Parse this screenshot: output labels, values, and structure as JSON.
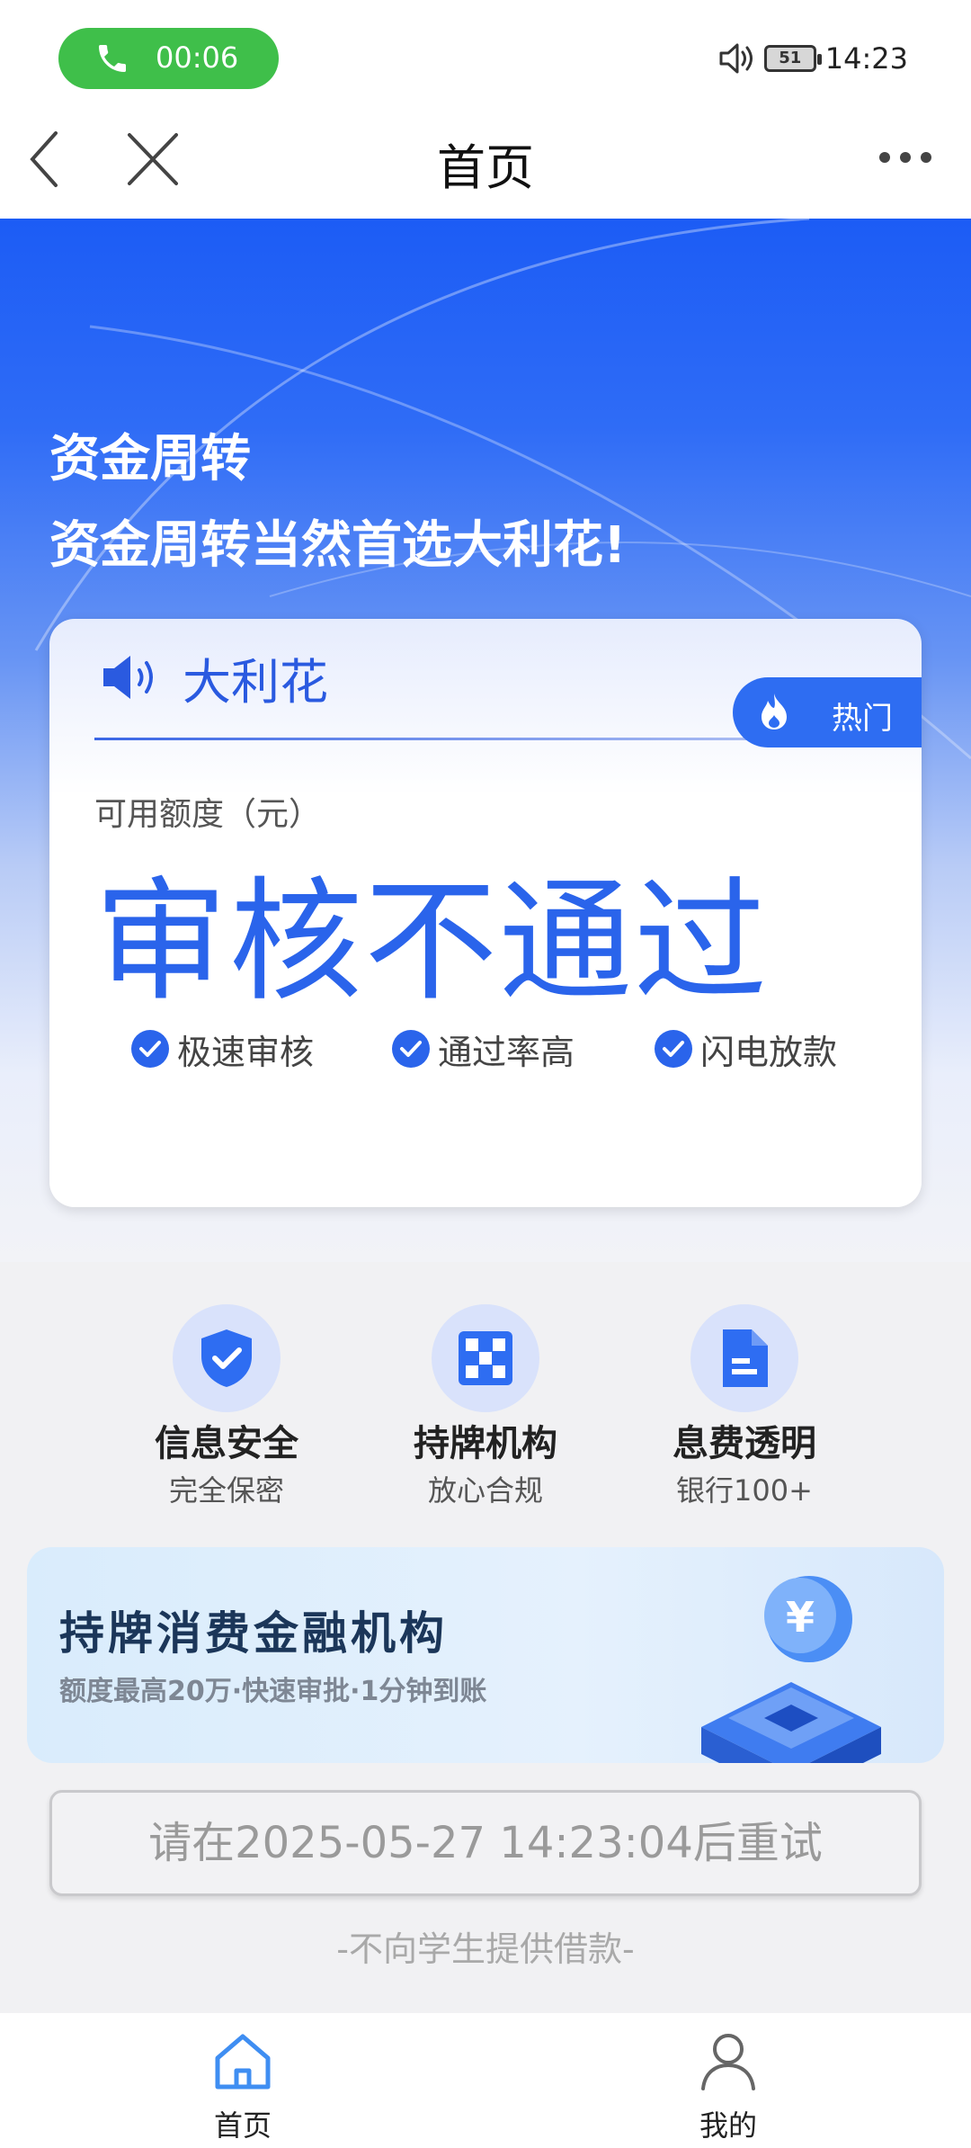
{
  "status_bar": {
    "call_timer": "00:06",
    "battery": "51",
    "clock": "14:23"
  },
  "nav": {
    "title": "首页"
  },
  "hero": {
    "headline1": "资金周转",
    "headline2": "资金周转当然首选大利花!"
  },
  "card": {
    "brand": "大利花",
    "hot_badge": "热门",
    "available_label": "可用额度（元）",
    "status_value": "审核不通过",
    "features": [
      "极速审核",
      "通过率高",
      "闪电放款"
    ]
  },
  "info": [
    {
      "title": "信息安全",
      "sub": "完全保密",
      "icon": "shield-check-icon"
    },
    {
      "title": "持牌机构",
      "sub": "放心合规",
      "icon": "checker-grid-icon"
    },
    {
      "title": "息费透明",
      "sub": "银行100+",
      "icon": "document-icon"
    }
  ],
  "banner": {
    "title": "持牌消费金融机构",
    "subtitle": "额度最高20万·快速审批·1分钟到账"
  },
  "retry_button": "请在2025-05-27 14:23:04后重试",
  "notice": "-不向学生提供借款-",
  "tabs": [
    {
      "label": "首页",
      "icon": "home-icon",
      "active": true
    },
    {
      "label": "我的",
      "icon": "user-icon",
      "active": false
    }
  ],
  "colors": {
    "accent": "#2a64eb",
    "call_green": "#3fbf4a",
    "hero_top": "#1c5cf5"
  }
}
